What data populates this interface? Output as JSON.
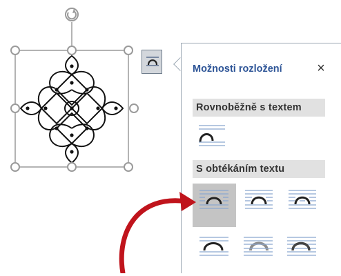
{
  "rotate_handle": {
    "icon": "rotate-icon"
  },
  "layout_options_button": {
    "icon": "wrap-inline-icon"
  },
  "panel": {
    "title": "Možnosti rozložení",
    "close_label": "×",
    "sections": [
      {
        "heading": "Rovnoběžně s textem",
        "options": [
          {
            "icon": "wrap-inline-icon"
          }
        ]
      },
      {
        "heading": "S obtékáním textu",
        "options": [
          {
            "icon": "wrap-square-icon",
            "selected": true
          },
          {
            "icon": "wrap-tight-icon"
          },
          {
            "icon": "wrap-through-icon"
          },
          {
            "icon": "wrap-top-bottom-icon"
          },
          {
            "icon": "wrap-behind-text-icon"
          },
          {
            "icon": "wrap-in-front-of-text-icon"
          }
        ]
      }
    ]
  },
  "colors": {
    "accent": "#2e5597",
    "arrow": "#c0141c",
    "selected": "#c4c4c4",
    "line": "#8aa6cf"
  }
}
